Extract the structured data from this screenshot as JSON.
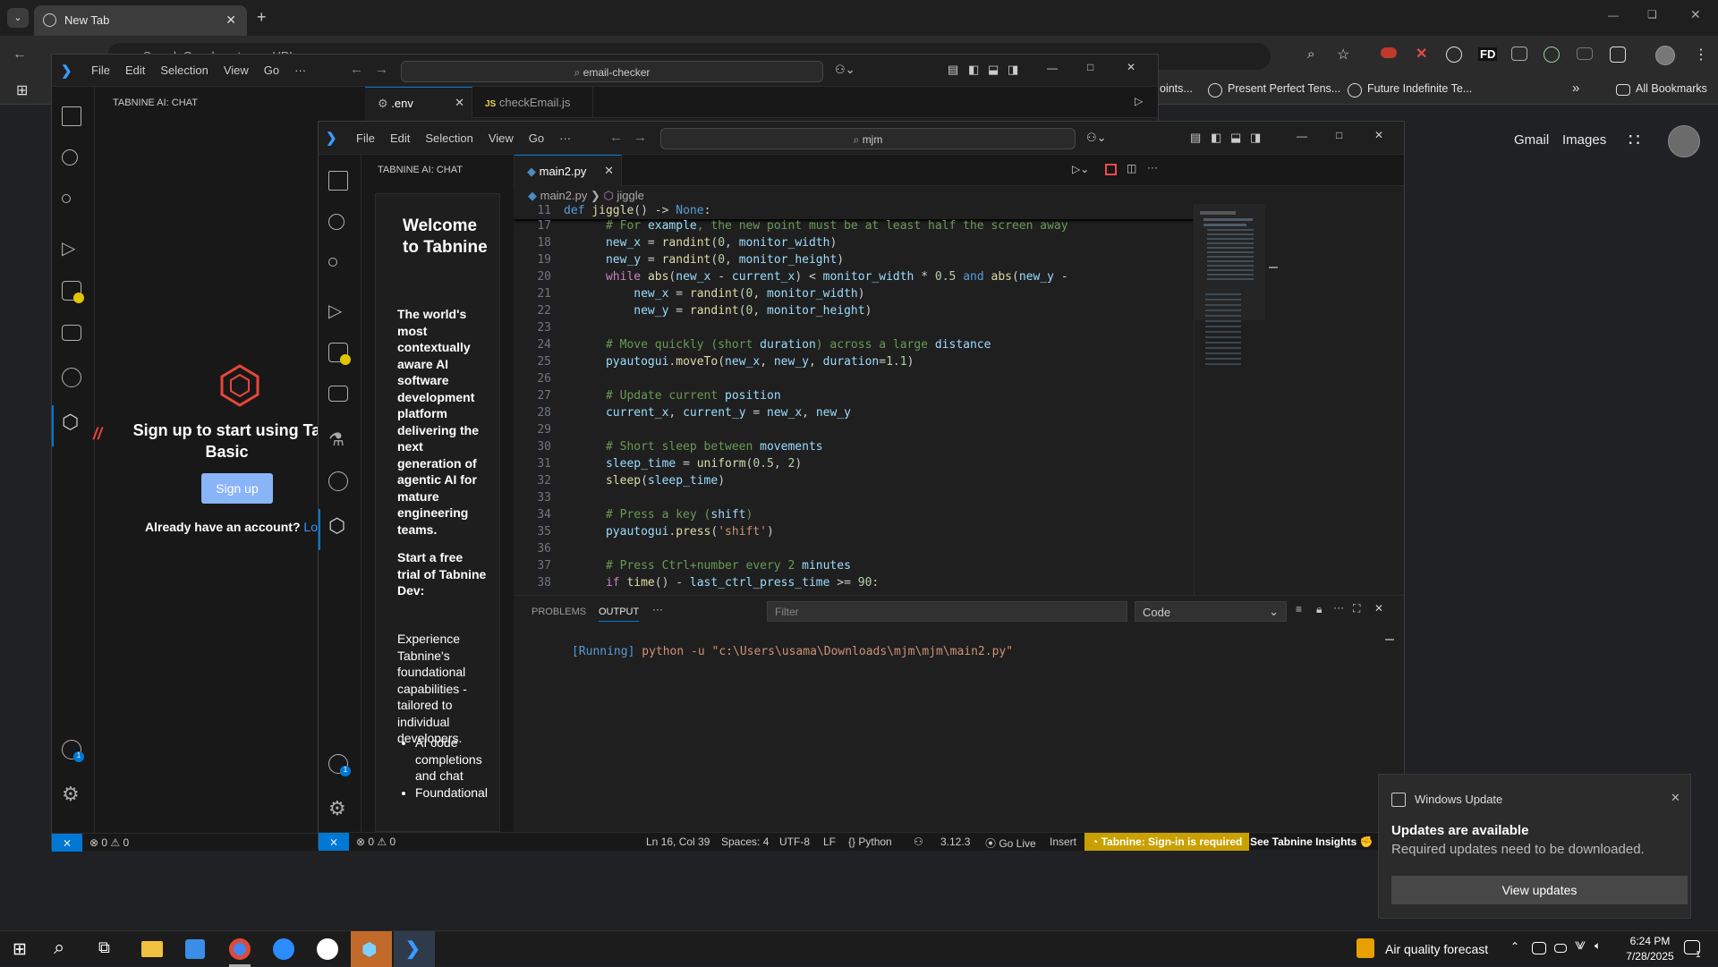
{
  "chrome": {
    "tab_title": "New Tab",
    "url_partial": "Search Google or type a URL",
    "bookmarks": [
      "oints...",
      "Present Perfect Tens...",
      "Future Indefinite Te..."
    ],
    "all_bookmarks": "All Bookmarks",
    "gmail": "Gmail",
    "images": "Images",
    "fd_label": "FD"
  },
  "vscode_back": {
    "menu": [
      "File",
      "Edit",
      "Selection",
      "View",
      "Go",
      "···"
    ],
    "search": "email-checker",
    "sidebar_title": "TABNINE AI: CHAT",
    "tabs": [
      {
        "label": ".env",
        "icon": "⚙"
      },
      {
        "label": "checkEmail.js",
        "icon": "JS"
      }
    ],
    "signup_heading": "Sign up to start using Ta Basic",
    "signup_button": "Sign up",
    "already": "Already have an account?",
    "login_partial": "Lo",
    "status_errors": "0",
    "status_warnings": "0",
    "slashes": "//"
  },
  "vscode_front": {
    "menu": [
      "File",
      "Edit",
      "Selection",
      "View",
      "Go",
      "···"
    ],
    "search": "mjm",
    "sidebar_title": "TABNINE AI: CHAT",
    "active_tab": "main2.py",
    "breadcrumb_file": "main2.py",
    "breadcrumb_symbol": "jiggle",
    "sticky_line_num": "11",
    "welcome": {
      "title": "Welcome to Tabnine",
      "para1": "The world's most contextually aware AI software development platform delivering the next generation of agentic AI for mature engineering teams.",
      "para2": "Start a free trial of Tabnine Dev:",
      "para3": "Experience Tabnine's foundational capabilities - tailored to individual developers.",
      "bullets": [
        "AI code completions and chat",
        "Foundational"
      ]
    },
    "line_numbers": [
      "17",
      "18",
      "19",
      "20",
      "21",
      "22",
      "23",
      "24",
      "25",
      "26",
      "27",
      "28",
      "29",
      "30",
      "31",
      "32",
      "33",
      "34",
      "35",
      "36",
      "37",
      "38"
    ],
    "panel": {
      "tab_problems": "PROBLEMS",
      "tab_output": "OUTPUT",
      "filter_placeholder": "Filter",
      "dropdown": "Code",
      "running_prefix": "[Running]",
      "running_cmd": "python -u \"c:\\Users\\usama\\Downloads\\mjm\\mjm\\main2.py\""
    },
    "status": {
      "errors": "0",
      "warnings": "0",
      "position": "Ln 16, Col 39",
      "spaces": "Spaces: 4",
      "encoding": "UTF-8",
      "eol": "LF",
      "language": "Python",
      "version": "3.12.3",
      "golive": "Go Live",
      "insert": "Insert",
      "tabnine": "Tabnine: Sign-in is required",
      "insights": "See Tabnine Insights"
    }
  },
  "toast": {
    "app": "Windows Update",
    "title": "Updates are available",
    "body": "Required updates need to be downloaded.",
    "button": "View updates"
  },
  "taskbar": {
    "weather": "Air quality forecast",
    "time": "6:24 PM",
    "date": "7/28/2025",
    "notif_count": "1"
  },
  "colors": {
    "accent": "#0078d4",
    "tabnine_warning": "#c9a000",
    "signup_button": "#8ab4f8",
    "taskbar_active": "#c26a2a"
  }
}
